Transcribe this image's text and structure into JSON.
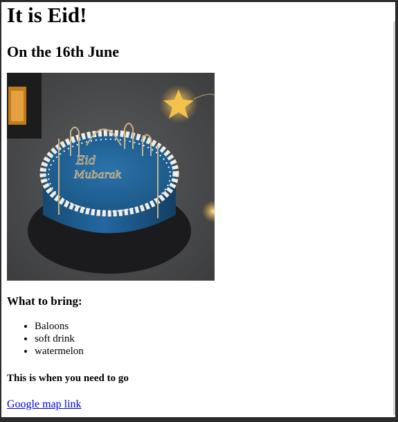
{
  "page": {
    "title": "It is Eid!",
    "date_heading": "On the 16th June",
    "image_alt": "Eid Mubarak cake",
    "image_text_line1": "Eid",
    "image_text_line2": "Mubarak",
    "bring_heading": "What to bring:",
    "bring_items": [
      "Baloons",
      "soft drink",
      "watermelon"
    ],
    "when_heading": "This is when you need to go",
    "map_link_label": "Google map link"
  },
  "colors": {
    "page_background": "#ffffff",
    "link": "#0000ee",
    "cake_blue": "#1f5f8f",
    "frosting": "#f2eee6",
    "background_stone": "#4a4b4d"
  }
}
